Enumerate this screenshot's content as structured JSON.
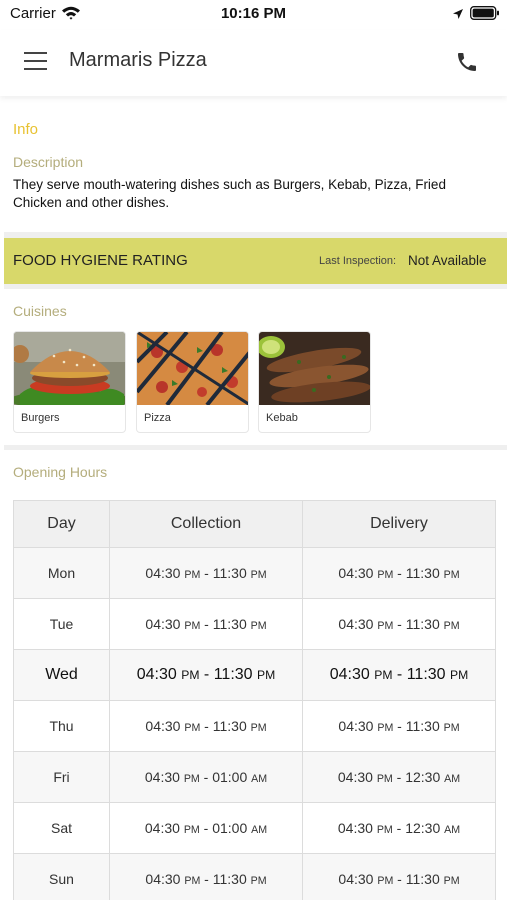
{
  "status_bar": {
    "carrier": "Carrier",
    "time": "10:16 PM",
    "icons": [
      "wifi-icon",
      "location-arrow-icon",
      "battery-icon"
    ]
  },
  "header": {
    "title": "Marmaris Pizza",
    "menu_icon": "hamburger-menu-icon",
    "phone_icon": "phone-icon"
  },
  "info": {
    "heading": "Info",
    "description_label": "Description",
    "description_text": "They serve mouth-watering dishes such as Burgers, Kebab, Pizza, Fried Chicken and other dishes."
  },
  "hygiene": {
    "title": "FOOD HYGIENE RATING",
    "last_inspection_label": "Last Inspection:",
    "last_inspection_value": "Not Available",
    "color": "#d8d86a"
  },
  "cuisines": {
    "label": "Cuisines",
    "items": [
      {
        "name": "Burgers"
      },
      {
        "name": "Pizza"
      },
      {
        "name": "Kebab"
      }
    ]
  },
  "opening_hours": {
    "label": "Opening Hours",
    "columns": [
      "Day",
      "Collection",
      "Delivery"
    ],
    "rows": [
      {
        "day": "Mon",
        "collection": {
          "start": "04:30",
          "start_period": "PM",
          "end": "11:30",
          "end_period": "PM"
        },
        "delivery": {
          "start": "04:30",
          "start_period": "PM",
          "end": "11:30",
          "end_period": "PM"
        }
      },
      {
        "day": "Tue",
        "collection": {
          "start": "04:30",
          "start_period": "PM",
          "end": "11:30",
          "end_period": "PM"
        },
        "delivery": {
          "start": "04:30",
          "start_period": "PM",
          "end": "11:30",
          "end_period": "PM"
        }
      },
      {
        "day": "Wed",
        "collection": {
          "start": "04:30",
          "start_period": "PM",
          "end": "11:30",
          "end_period": "PM"
        },
        "delivery": {
          "start": "04:30",
          "start_period": "PM",
          "end": "11:30",
          "end_period": "PM"
        }
      },
      {
        "day": "Thu",
        "collection": {
          "start": "04:30",
          "start_period": "PM",
          "end": "11:30",
          "end_period": "PM"
        },
        "delivery": {
          "start": "04:30",
          "start_period": "PM",
          "end": "11:30",
          "end_period": "PM"
        }
      },
      {
        "day": "Fri",
        "collection": {
          "start": "04:30",
          "start_period": "PM",
          "end": "01:00",
          "end_period": "AM"
        },
        "delivery": {
          "start": "04:30",
          "start_period": "PM",
          "end": "12:30",
          "end_period": "AM"
        }
      },
      {
        "day": "Sat",
        "collection": {
          "start": "04:30",
          "start_period": "PM",
          "end": "01:00",
          "end_period": "AM"
        },
        "delivery": {
          "start": "04:30",
          "start_period": "PM",
          "end": "12:30",
          "end_period": "AM"
        }
      },
      {
        "day": "Sun",
        "collection": {
          "start": "04:30",
          "start_period": "PM",
          "end": "11:30",
          "end_period": "PM"
        },
        "delivery": {
          "start": "04:30",
          "start_period": "PM",
          "end": "11:30",
          "end_period": "PM"
        }
      }
    ],
    "highlighted_day": "Wed"
  },
  "colors": {
    "info_heading": "#e8c231",
    "section_label": "#b4ad7c",
    "hygiene_bar": "#d8d86a"
  }
}
